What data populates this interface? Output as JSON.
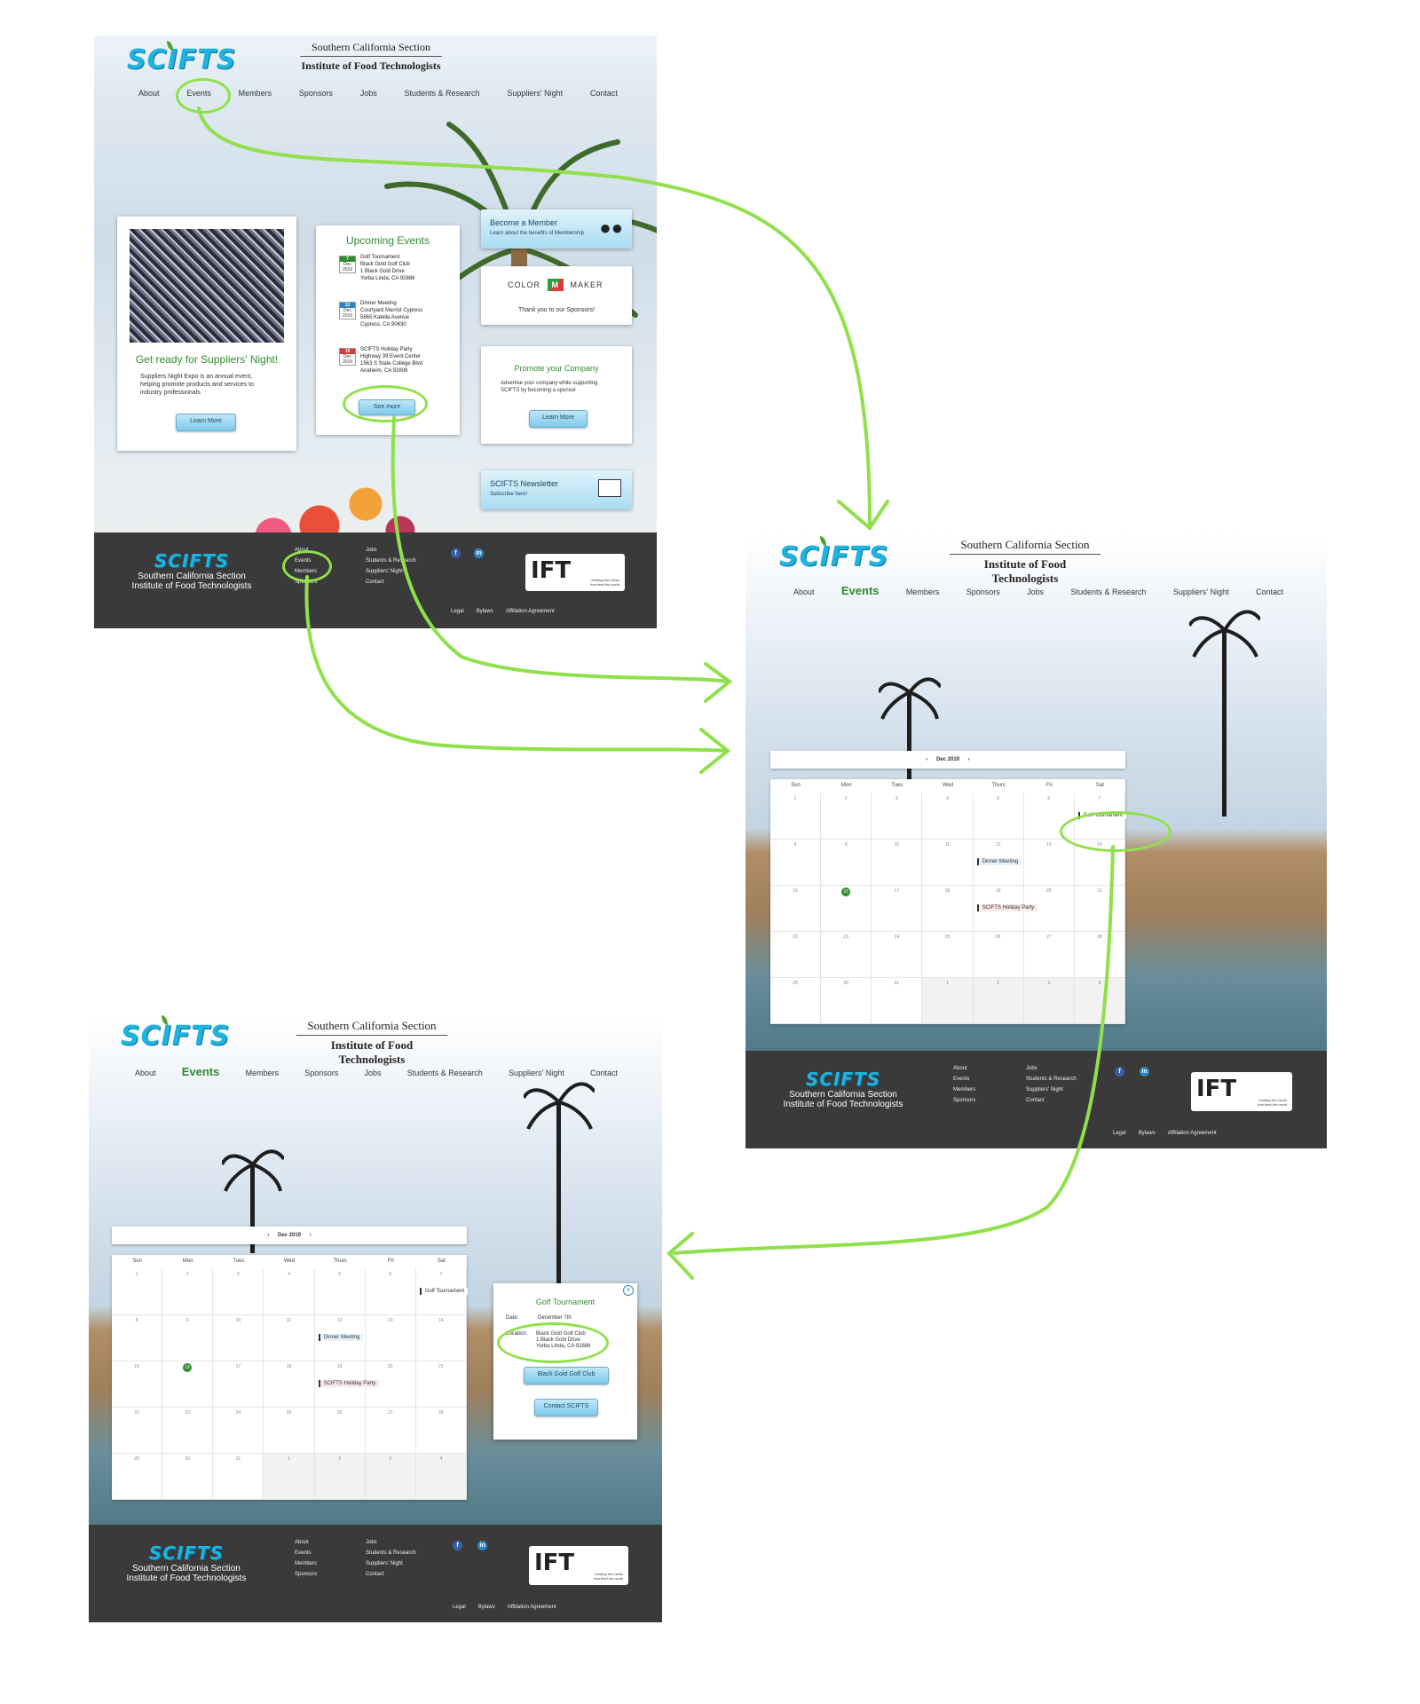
{
  "site": {
    "logo": "SCIFTS",
    "section_line1": "Southern California Section",
    "section_line2": "Institute of Food Technologists"
  },
  "nav": [
    "About",
    "Events",
    "Members",
    "Sponsors",
    "Jobs",
    "Students & Research",
    "Suppliers' Night",
    "Contact"
  ],
  "home": {
    "suppliers_card": {
      "title": "Get ready for Suppliers' Night!",
      "body": "Suppliers Night Expo is an annual event, helping promote products and services to industry professionals",
      "button": "Learn More"
    },
    "upcoming": {
      "title": "Upcoming Events",
      "events": [
        {
          "day": "7",
          "month": "Dec",
          "year": "2019",
          "color": "#2e8b2e",
          "lines": [
            "Golf Tournament",
            "Black Gold Golf Club",
            "1 Black Gold Drive",
            "Yorba Linda, CA 92886"
          ]
        },
        {
          "day": "12",
          "month": "Dec",
          "year": "2019",
          "color": "#2a86c8",
          "lines": [
            "Dinner Meeting",
            "Courtyard Marriot Cypress",
            "5865 Katella Avenue",
            "Cypress, CA 90630"
          ]
        },
        {
          "day": "19",
          "month": "Dec",
          "year": "2019",
          "color": "#d23a3a",
          "lines": [
            "SCIFTS Holiday Party",
            "Highway 39 Event Center",
            "1563 S State College Blvd",
            "Anaheim, CA 92806"
          ]
        }
      ],
      "button": "See more"
    },
    "member_card": {
      "title": "Become a Member",
      "sub": "Learn about the benefits of Membership"
    },
    "sponsor_card": {
      "brand_left": "COLOR",
      "brand_mid": "M",
      "brand_right": "MAKER",
      "thanks": "Thank you to our Sponsors!"
    },
    "promote_card": {
      "title": "Promote your Company",
      "body": "Advertise your company while supporting SCIFTS by becoming a sponsor",
      "button": "Learn More"
    },
    "newsletter_card": {
      "title": "SCIFTS Newsletter",
      "sub": "Subscribe here!"
    }
  },
  "footer": {
    "col1": [
      "About",
      "Events",
      "Members",
      "Sponsors"
    ],
    "col2": [
      "Jobs",
      "Students & Research",
      "Suppliers' Night",
      "Contact"
    ],
    "legal": [
      "Legal",
      "Bylaws",
      "Affiliation Agreement"
    ],
    "ift": "IFT",
    "ift_tag": "feeding the minds that feed the world",
    "social": [
      "f",
      "in"
    ]
  },
  "calendar": {
    "month_label": "Dec 2019",
    "prev": "‹",
    "next": "›",
    "days": [
      "Sun",
      "Mon",
      "Tues",
      "Wed",
      "Thurs",
      "Fri",
      "Sat"
    ],
    "cells": [
      "1",
      "2",
      "3",
      "4",
      "5",
      "6",
      "7",
      "8",
      "9",
      "10",
      "11",
      "12",
      "13",
      "14",
      "15",
      "16",
      "17",
      "18",
      "19",
      "20",
      "21",
      "22",
      "23",
      "24",
      "25",
      "26",
      "27",
      "28",
      "29",
      "30",
      "31",
      "1",
      "2",
      "3",
      "4"
    ],
    "today_index": 15,
    "events": [
      {
        "label": "Golf Tournament",
        "cell": 6,
        "bg": "#ffffff",
        "bar": "#333"
      },
      {
        "label": "Dinner Meeting",
        "cell": 11,
        "bg": "#e6f2fb",
        "bar": "#333"
      },
      {
        "label": "SCIFTS Holiday Party",
        "cell": 18,
        "bg": "#fbe9e9",
        "bar": "#333"
      }
    ]
  },
  "popup": {
    "close": "x",
    "title": "Golf Tournament",
    "date_label": "Date:",
    "date_value": "December 7th",
    "location_label": "Location:",
    "location_lines": [
      "Black Gold Golf Club",
      "1 Black Gold Drive",
      "Yorba Linda, CA 92886"
    ],
    "button1": "Black Gold Golf Club",
    "button2": "Contact SCIFTS"
  }
}
